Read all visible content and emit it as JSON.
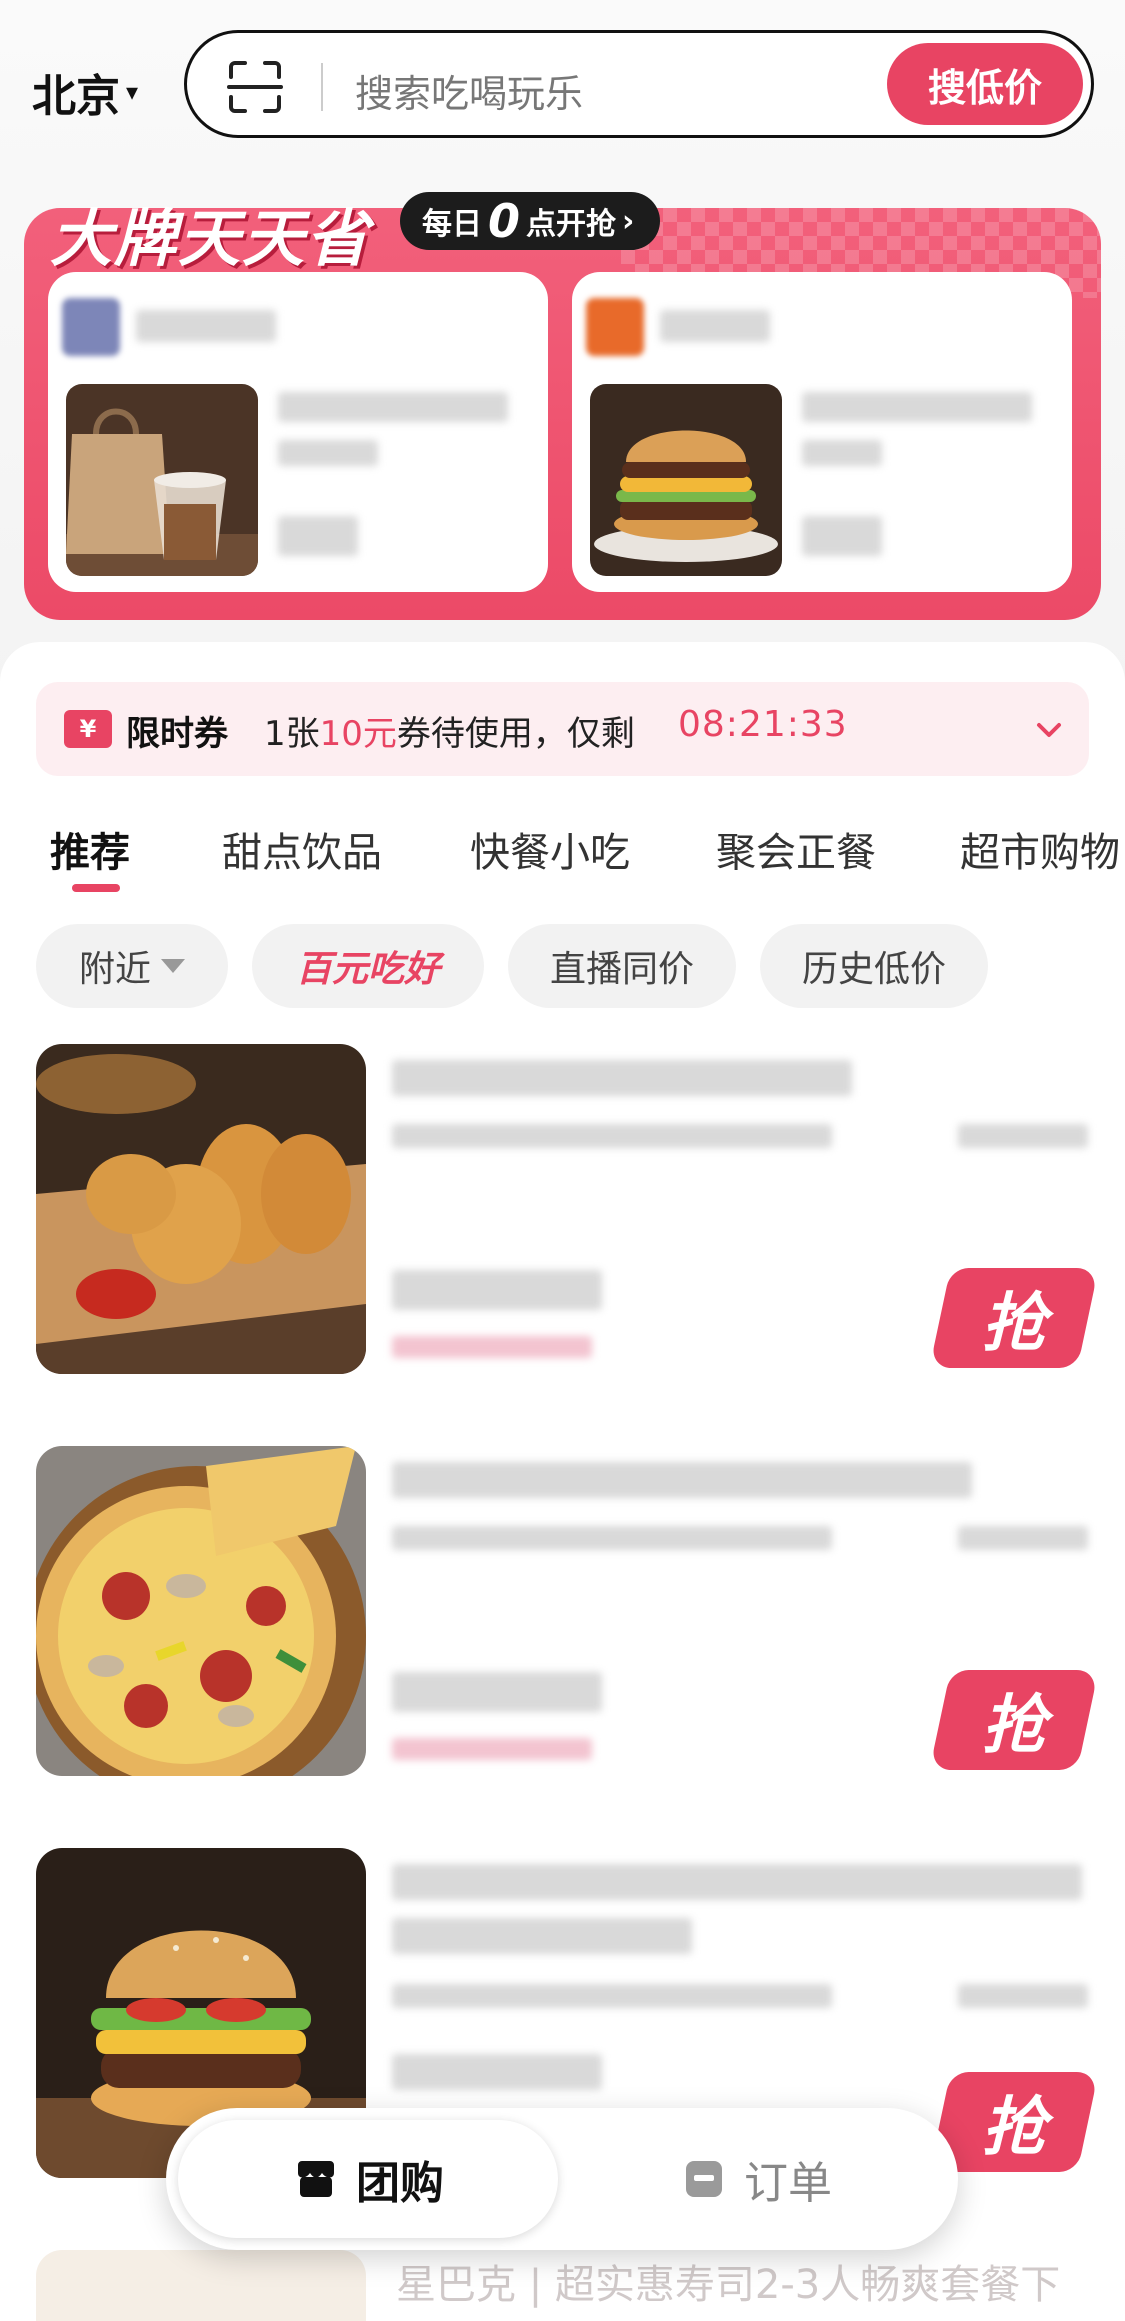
{
  "header": {
    "city": "北京",
    "search_placeholder": "搜索吃喝玩乐",
    "search_button": "搜低价"
  },
  "promo": {
    "title": "大牌天天省",
    "badge_prefix": "每日",
    "badge_number": "0",
    "badge_suffix": "点开抢",
    "badge_arrow": "›"
  },
  "coupon": {
    "icon": "¥",
    "label": "限时券",
    "text_prefix": "1张",
    "amount": "10元",
    "text_suffix": "券待使用，仅剩",
    "timer": "08:21:33"
  },
  "tabs": [
    {
      "label": "推荐"
    },
    {
      "label": "甜点饮品"
    },
    {
      "label": "快餐小吃"
    },
    {
      "label": "聚会正餐"
    },
    {
      "label": "超市购物"
    }
  ],
  "chips": [
    {
      "label": "附近"
    },
    {
      "label": "百元吃好"
    },
    {
      "label": "直播同价"
    },
    {
      "label": "历史低价"
    }
  ],
  "grab_label": "抢",
  "listing_peek_text": "星巴克 | 超实惠寿司2-3人畅爽套餐下",
  "bottom_nav": {
    "group_buy": "团购",
    "orders": "订单"
  },
  "colors": {
    "accent": "#e84463",
    "promo_bg": "#ef5470",
    "coupon_bg": "#fdeef1"
  }
}
